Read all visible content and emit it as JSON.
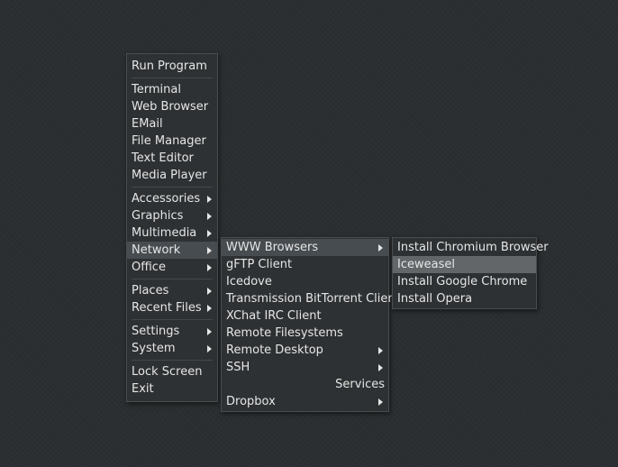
{
  "root_menu": {
    "groups": [
      [
        {
          "label": "Run Program",
          "submenu": false
        }
      ],
      [
        {
          "label": "Terminal",
          "submenu": false
        },
        {
          "label": "Web Browser",
          "submenu": false
        },
        {
          "label": "EMail",
          "submenu": false
        },
        {
          "label": "File Manager",
          "submenu": false
        },
        {
          "label": "Text Editor",
          "submenu": false
        },
        {
          "label": "Media Player",
          "submenu": false
        }
      ],
      [
        {
          "label": "Accessories",
          "submenu": true
        },
        {
          "label": "Graphics",
          "submenu": true
        },
        {
          "label": "Multimedia",
          "submenu": true
        },
        {
          "label": "Network",
          "submenu": true
        },
        {
          "label": "Office",
          "submenu": true
        }
      ],
      [
        {
          "label": "Places",
          "submenu": true
        },
        {
          "label": "Recent Files",
          "submenu": true
        }
      ],
      [
        {
          "label": "Settings",
          "submenu": true
        },
        {
          "label": "System",
          "submenu": true
        }
      ],
      [
        {
          "label": "Lock Screen",
          "submenu": false
        },
        {
          "label": "Exit",
          "submenu": false
        }
      ]
    ]
  },
  "network_menu": {
    "items": [
      {
        "label": "WWW Browsers",
        "submenu": true
      },
      {
        "label": "gFTP Client",
        "submenu": false
      },
      {
        "label": "Icedove",
        "submenu": false
      },
      {
        "label": "Transmission BitTorrent Client",
        "submenu": false
      },
      {
        "label": "XChat IRC Client",
        "submenu": false
      },
      {
        "label": "Remote Filesystems",
        "submenu": false
      },
      {
        "label": "Remote Desktop",
        "submenu": true
      },
      {
        "label": "SSH",
        "submenu": true
      },
      {
        "label": "Services",
        "submenu": false
      },
      {
        "label": "Dropbox",
        "submenu": true
      }
    ]
  },
  "browsers_menu": {
    "items": [
      {
        "label": "Install Chromium Browser",
        "submenu": false
      },
      {
        "label": "Iceweasel",
        "submenu": false
      },
      {
        "label": "Install Google Chrome",
        "submenu": false
      },
      {
        "label": "Install Opera",
        "submenu": false
      }
    ]
  },
  "colors": {
    "desktop_background": "#2b2e30",
    "menu_background": "#2e3133",
    "menu_border": "#4a4d50",
    "active_path_highlight": "#474c50",
    "hover_highlight": "#626668",
    "text": "#e6e6e6"
  }
}
